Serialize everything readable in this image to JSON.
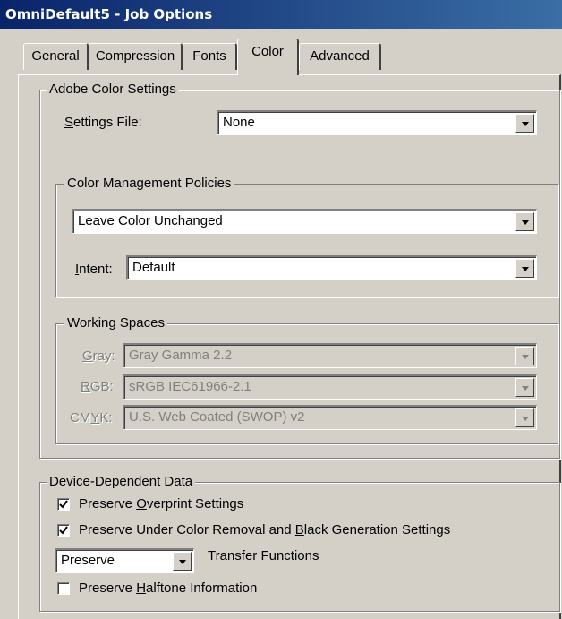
{
  "window": {
    "title": "OmniDefault5 - Job Options"
  },
  "tabs": [
    {
      "label": "General"
    },
    {
      "label": "Compression"
    },
    {
      "label": "Fonts"
    },
    {
      "label": "Color",
      "active": true
    },
    {
      "label": "Advanced"
    }
  ],
  "adobe_color_settings": {
    "group_label": "Adobe Color Settings",
    "settings_file_label_u": "S",
    "settings_file_label_rest": "ettings File:",
    "settings_file_value": "None"
  },
  "color_management": {
    "group_label": "Color Management Policies",
    "policy_value": "Leave Color Unchanged",
    "intent_label_u": "I",
    "intent_label_rest": "ntent:",
    "intent_value": "Default"
  },
  "working_spaces": {
    "group_label": "Working Spaces",
    "gray_label_u": "G",
    "gray_label_rest": "ray:",
    "gray_value": "Gray Gamma 2.2",
    "rgb_label_u": "R",
    "rgb_label_rest": "GB:",
    "rgb_value": "sRGB IEC61966-2.1",
    "cmyk_label_pre": "CM",
    "cmyk_label_u": "Y",
    "cmyk_label_rest": "K:",
    "cmyk_value": "U.S. Web Coated (SWOP) v2"
  },
  "device_dependent": {
    "group_label": "Device-Dependent Data",
    "overprint_pre": "Preserve ",
    "overprint_u": "O",
    "overprint_rest": "verprint Settings",
    "overprint_checked": true,
    "ucr_pre": "Preserve Under Color Removal and ",
    "ucr_u": "B",
    "ucr_rest": "lack Generation Settings",
    "ucr_checked": true,
    "transfer_value": "Preserve",
    "transfer_label": "Transfer Functions",
    "halftone_pre": "Preserve ",
    "halftone_u": "H",
    "halftone_rest": "alftone Information",
    "halftone_checked": false
  }
}
